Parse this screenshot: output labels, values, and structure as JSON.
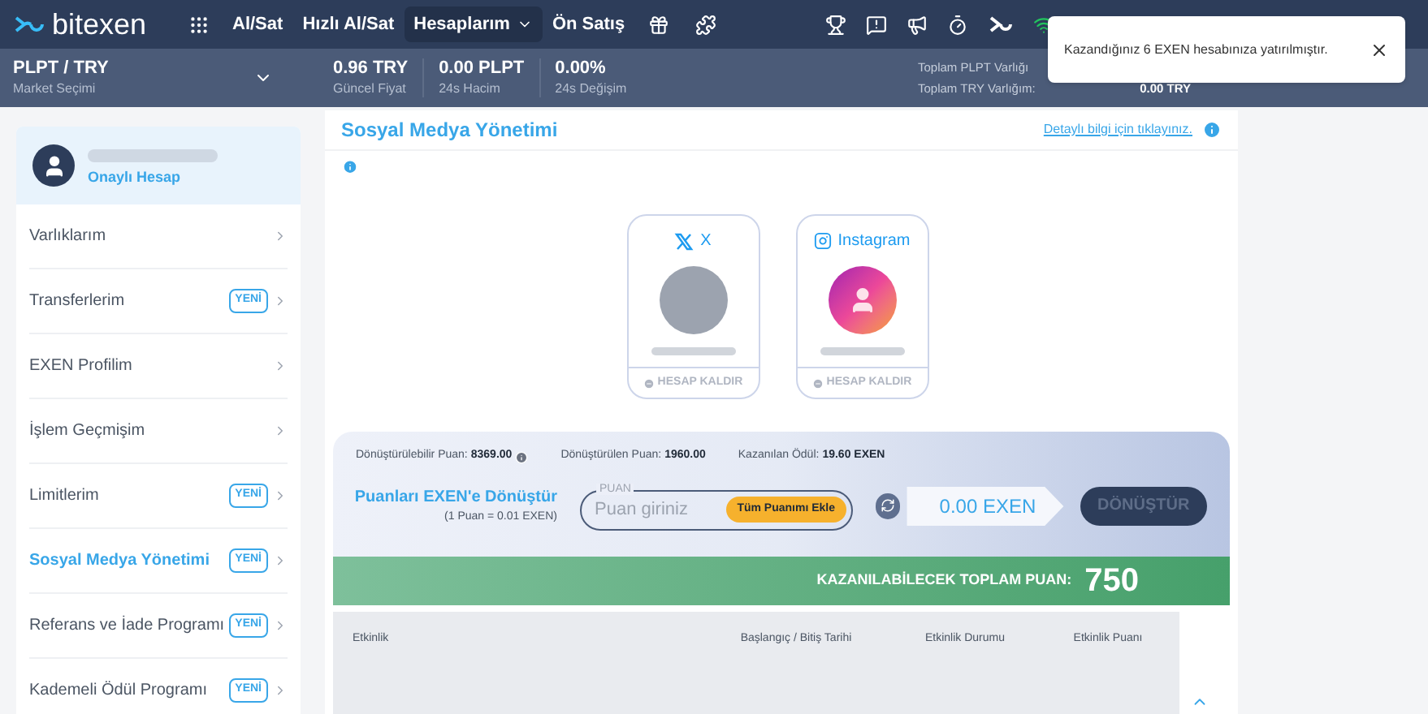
{
  "nav": {
    "logo": "bitexen",
    "items": [
      {
        "label": "Al/Sat",
        "selected": false
      },
      {
        "label": "Hızlı Al/Sat",
        "selected": false
      },
      {
        "label": "Hesaplarım",
        "selected": true,
        "dropdown": true
      },
      {
        "label": "Ön Satış",
        "selected": false
      }
    ]
  },
  "market": {
    "pair": "PLPT / TRY",
    "pair_caption": "Market Seçimi",
    "stats": [
      {
        "value": "0.96 TRY",
        "caption": "Güncel Fiyat"
      },
      {
        "value": "0.00 PLPT",
        "caption": "24s Hacim"
      },
      {
        "value": "0.00%",
        "caption": "24s Değişim"
      }
    ],
    "totals": [
      {
        "label": "Toplam PLPT Varlığı"
      },
      {
        "label": "Toplam TRY Varlığım:",
        "value": "0.00 TRY"
      }
    ]
  },
  "toast": {
    "message": "Kazandığınız 6 EXEN hesabınıza yatırılmıştır."
  },
  "sidebar": {
    "account_status": "Onaylı Hesap",
    "items": [
      {
        "label": "Varlıklarım",
        "selected": false
      },
      {
        "label": "Transferlerim",
        "badge": "YENİ",
        "selected": false
      },
      {
        "label": "EXEN Profilim",
        "selected": false
      },
      {
        "label": "İşlem Geçmişim",
        "selected": false
      },
      {
        "label": "Limitlerim",
        "badge": "YENİ",
        "selected": false
      },
      {
        "label": "Sosyal Medya Yönetimi",
        "badge": "YENİ",
        "selected": true
      },
      {
        "label": "Referans ve İade Programı",
        "badge": "YENİ",
        "selected": false
      },
      {
        "label": "Kademeli Ödül Programı",
        "badge": "YENİ",
        "selected": false
      }
    ]
  },
  "page": {
    "title": "Sosyal Medya Yönetimi",
    "info_link": "Detaylı bilgi için tıklayınız.",
    "accounts": [
      {
        "kind": "x",
        "name": "X",
        "action": "HESAP KALDIR"
      },
      {
        "kind": "instagram",
        "name": "Instagram",
        "action": "HESAP KALDIR"
      }
    ],
    "convert": {
      "stats": [
        {
          "label": "Dönüştürülebilir Puan:",
          "value": "8369.00"
        },
        {
          "label": "Dönüştürülen Puan:",
          "value": "1960.00"
        },
        {
          "label": "Kazanılan Ödül:",
          "value": "19.60 EXEN"
        }
      ],
      "title": "Puanları EXEN'e Dönüştür",
      "rate": "(1 Puan = 0.01 EXEN)",
      "field_label": "PUAN",
      "placeholder": "Puan giriniz",
      "add_all": "Tüm Puanımı Ekle",
      "result": "0.00 EXEN",
      "button": "DÖNÜŞTÜR"
    },
    "total": {
      "label": "KAZANILABİLECEK TOPLAM PUAN:",
      "value": "750"
    },
    "table": {
      "columns": [
        "Etkinlik",
        "Başlangıç / Bitiş Tarihi",
        "Etkinlik Durumu",
        "Etkinlik Puanı"
      ]
    }
  }
}
